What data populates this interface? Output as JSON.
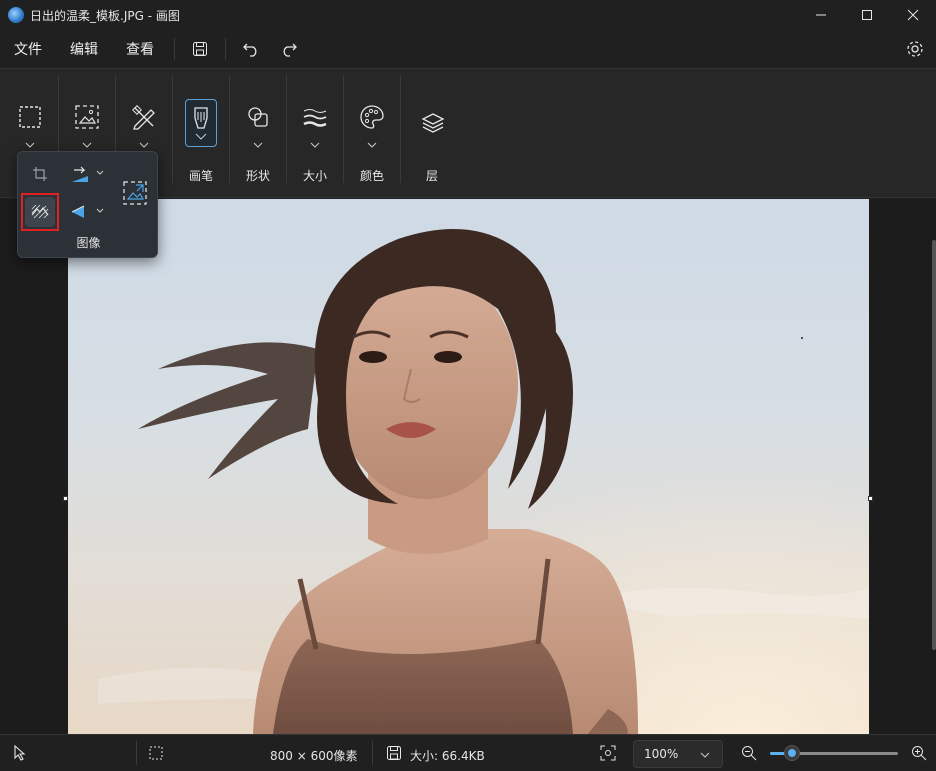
{
  "window": {
    "title": "日出的温柔_模板.JPG - 画图",
    "minimize": "—",
    "maximize": "☐",
    "close": "✕"
  },
  "menu": {
    "items": [
      "文件",
      "编辑",
      "查看"
    ],
    "quick": [
      "save-icon",
      "undo-icon",
      "redo-icon"
    ]
  },
  "ribbon": {
    "groups": [
      {
        "name": "selection",
        "label": ""
      },
      {
        "name": "image",
        "label": ""
      },
      {
        "name": "tools",
        "label": ""
      },
      {
        "name": "brushes",
        "label": "画笔"
      },
      {
        "name": "shapes",
        "label": "形状"
      },
      {
        "name": "size",
        "label": "大小"
      },
      {
        "name": "colors",
        "label": "颜色"
      },
      {
        "name": "layers",
        "label": "层"
      }
    ]
  },
  "image_popup": {
    "label": "图像",
    "items": [
      "crop-icon",
      "rotate-icon",
      "resize-icon",
      "remove-background-icon",
      "flip-icon"
    ],
    "highlighted": "remove-background-icon"
  },
  "status": {
    "dimensions": "800 × 600像素",
    "size": "大小: 66.4KB",
    "zoom": "100%",
    "zoom_fraction": 0.17
  },
  "colors": {
    "accent": "#5ab0f0",
    "highlight": "#e02020"
  }
}
